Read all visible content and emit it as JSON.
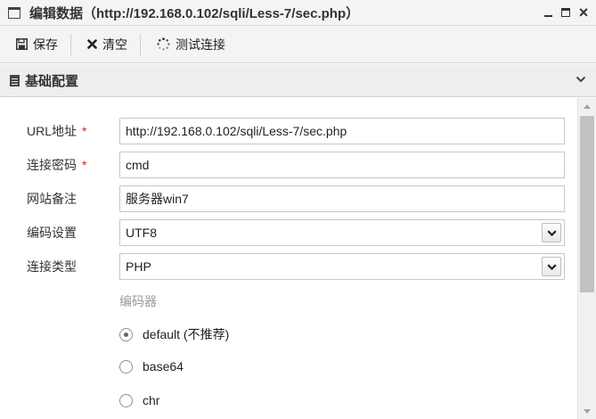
{
  "window": {
    "title": "编辑数据（http://192.168.0.102/sqli/Less-7/sec.php）",
    "minimize_icon": "minimize-icon",
    "maximize_icon": "maximize-icon",
    "close_label": "×"
  },
  "toolbar": {
    "save_label": "保存",
    "clear_label": "清空",
    "test_label": "测试连接"
  },
  "section": {
    "title": "基础配置"
  },
  "form": {
    "url_label": "URL地址",
    "url_value": "http://192.168.0.102/sqli/Less-7/sec.php",
    "password_label": "连接密码",
    "password_value": "cmd",
    "note_label": "网站备注",
    "note_value": "服务器win7",
    "encoding_label": "编码设置",
    "encoding_value": "UTF8",
    "type_label": "连接类型",
    "type_value": "PHP",
    "required_mark": "*"
  },
  "encoder": {
    "label": "编码器",
    "options": [
      {
        "label": "default (不推荐)",
        "checked": true
      },
      {
        "label": "base64",
        "checked": false
      },
      {
        "label": "chr",
        "checked": false
      }
    ]
  },
  "colors": {
    "required": "#e02020",
    "bar_bg": "#f4f4f4",
    "section_bg": "#eeeeee",
    "scroll_thumb": "#c1c1c1"
  }
}
